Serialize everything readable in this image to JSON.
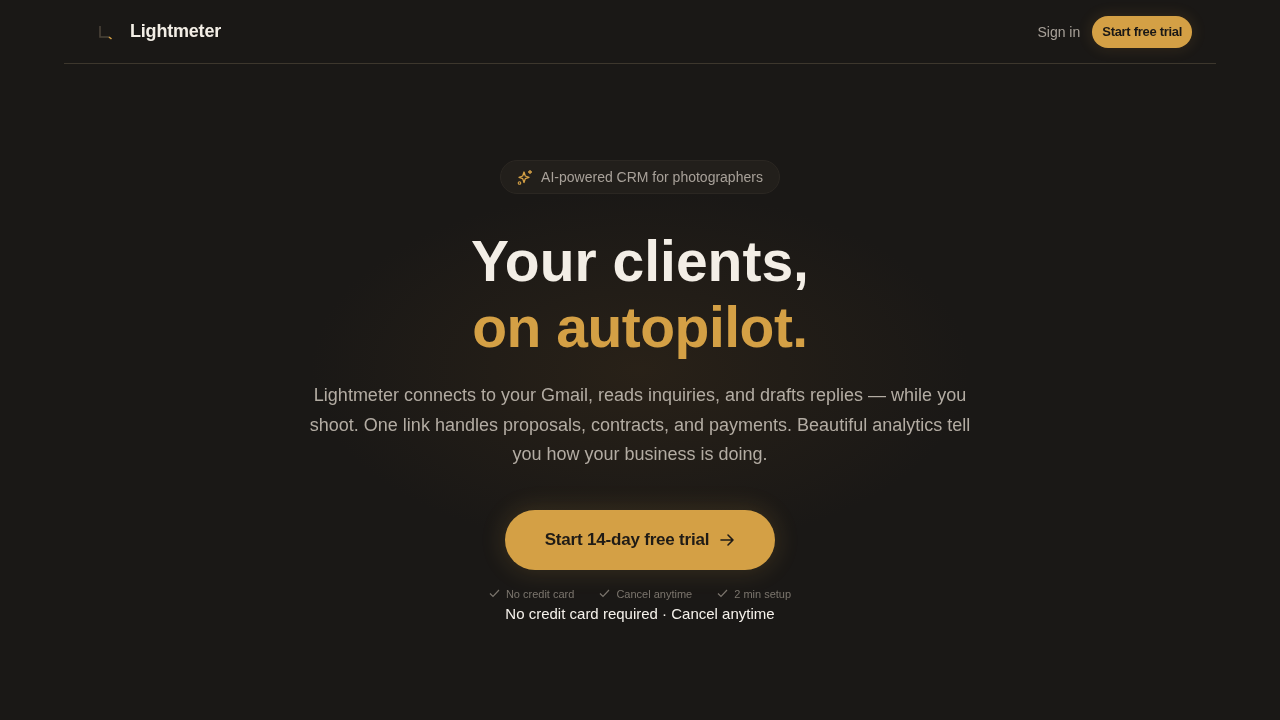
{
  "header": {
    "brand": "Lightmeter",
    "nav": [
      {
        "label": "Sign in",
        "kind": "link"
      },
      {
        "label": "Start free trial",
        "kind": "button"
      }
    ]
  },
  "hero": {
    "badge": "AI-powered CRM for photographers",
    "headline": "Your clients,",
    "headline_accent": "on autopilot.",
    "description": "Lightmeter connects to your Gmail, reads inquiries, and drafts replies — while you shoot. One link handles proposals, contracts, and payments. Beautiful analytics tell you how your business is doing.",
    "cta": "Start 14-day free trial",
    "perks": [
      "No credit card",
      "Cancel anytime",
      "2 min setup"
    ],
    "note": "No credit card required · Cancel anytime"
  }
}
